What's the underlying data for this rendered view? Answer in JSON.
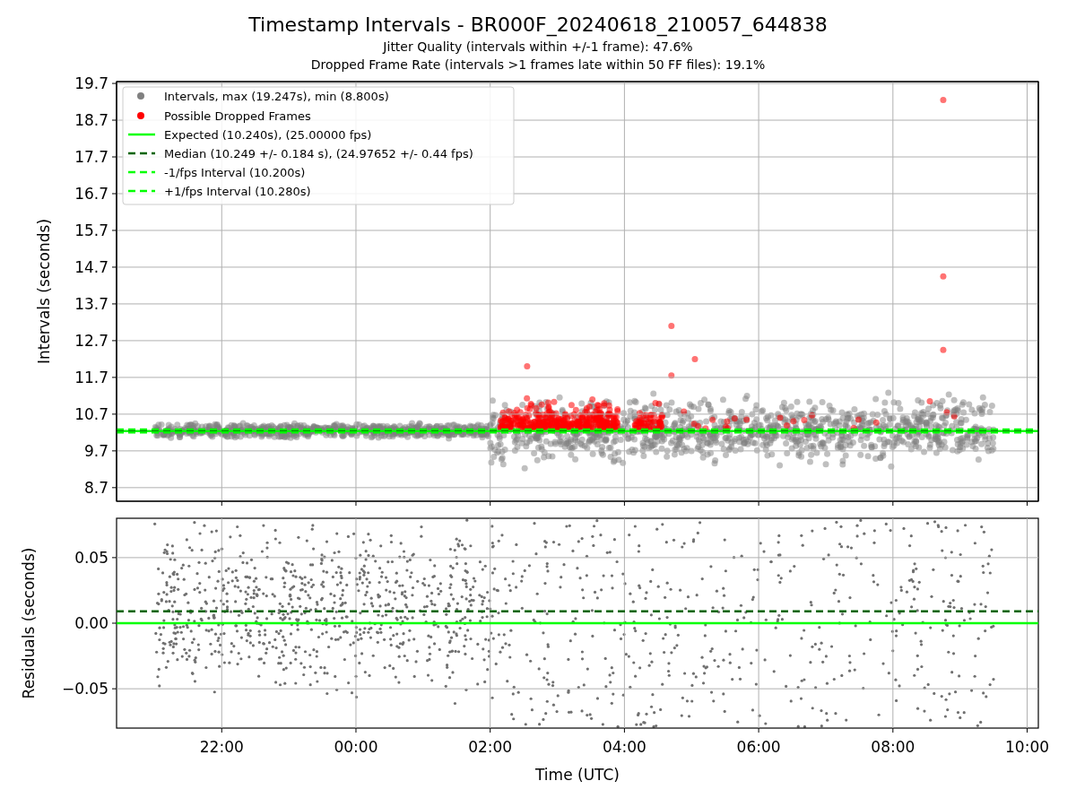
{
  "figure": {
    "title": "Timestamp Intervals - BR000F_20240618_210057_644838",
    "subtitles": [
      "Jitter Quality (intervals within +/-1 frame): 47.6%",
      "Dropped Frame Rate (intervals >1 frames late within 50 FF files): 19.1%"
    ]
  },
  "top_chart": {
    "legend_markers": [
      {
        "label": "Intervals, max (19.247s), min (8.800s)",
        "color": "#808080"
      },
      {
        "label": "Possible Dropped Frames",
        "color": "#ff0000"
      }
    ],
    "chart_data": {
      "type": "line",
      "ylabel": "Intervals (seconds)",
      "grid": true,
      "legend": true,
      "x": [
        "2024-06-18T20:26",
        "2024-06-19T10:10"
      ],
      "xlim": [
        "2024-06-18T20:26",
        "2024-06-19T10:10"
      ],
      "ylim": [
        8.33,
        19.75
      ],
      "yticks": [
        {
          "value": 8.7,
          "label": "8.7"
        },
        {
          "value": 9.7,
          "label": "9.7"
        },
        {
          "value": 10.7,
          "label": "10.7"
        },
        {
          "value": 11.7,
          "label": "11.7"
        },
        {
          "value": 12.7,
          "label": "12.7"
        },
        {
          "value": 13.7,
          "label": "13.7"
        },
        {
          "value": 14.7,
          "label": "14.7"
        },
        {
          "value": 15.7,
          "label": "15.7"
        },
        {
          "value": 16.7,
          "label": "16.7"
        },
        {
          "value": 17.7,
          "label": "17.7"
        },
        {
          "value": 18.7,
          "label": "18.7"
        },
        {
          "value": 19.7,
          "label": "19.7"
        }
      ],
      "series": [
        {
          "name": "Expected (10.240s), (25.00000 fps)",
          "color": "#00ff00",
          "line_style": "solid",
          "values": [
            10.24,
            10.24
          ]
        },
        {
          "name": "Median (10.249 +/- 0.184 s), (24.97652 +/- 0.44 fps)",
          "color": "#006400",
          "line_style": "dashed",
          "values": [
            10.25,
            10.25
          ]
        },
        {
          "name": "-1/fps Interval (10.200s)",
          "color": "#00ff00",
          "line_style": "dashed",
          "values": [
            10.2,
            10.2
          ]
        },
        {
          "name": "+1/fps Interval (10.280s)",
          "color": "#00ff00",
          "line_style": "dashed",
          "values": [
            10.28,
            10.28
          ]
        }
      ]
    }
  },
  "bottom_chart": {
    "chart_data": {
      "type": "line",
      "xlabel": "Time (UTC)",
      "ylabel": "Residuals (seconds)",
      "grid": true,
      "x": [
        "2024-06-18T20:26",
        "2024-06-19T10:10"
      ],
      "xlim": [
        "2024-06-18T20:26",
        "2024-06-19T10:10"
      ],
      "ylim": [
        -0.08,
        0.08
      ],
      "xticks": [
        {
          "value": "2024-06-18T22:00",
          "label": "22:00"
        },
        {
          "value": "2024-06-19T00:00",
          "label": "00:00"
        },
        {
          "value": "2024-06-19T02:00",
          "label": "02:00"
        },
        {
          "value": "2024-06-19T04:00",
          "label": "04:00"
        },
        {
          "value": "2024-06-19T06:00",
          "label": "06:00"
        },
        {
          "value": "2024-06-19T08:00",
          "label": "08:00"
        },
        {
          "value": "2024-06-19T10:00",
          "label": "10:00"
        }
      ],
      "yticks": [
        {
          "value": 0.05,
          "label": "0.05"
        },
        {
          "value": 0,
          "label": "0.00"
        },
        {
          "value": -0.05,
          "label": "−0.05"
        }
      ],
      "series": [
        {
          "color": "#00ff00",
          "line_style": "solid",
          "values": [
            0,
            0
          ]
        },
        {
          "color": "#006400",
          "line_style": "dashed",
          "values": [
            0.009,
            0.009
          ]
        }
      ]
    }
  }
}
